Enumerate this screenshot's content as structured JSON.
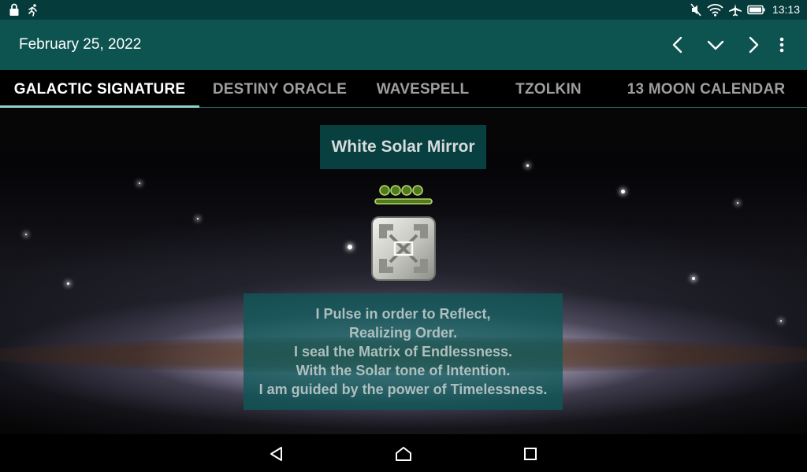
{
  "status_bar": {
    "time": "13:13",
    "left_icons": [
      "lock-icon",
      "running-person-icon"
    ],
    "right_icons": [
      "mute-icon",
      "wifi-icon",
      "airplane-icon",
      "battery-icon"
    ]
  },
  "app_bar": {
    "date": "February 25, 2022",
    "actions": [
      "chevron-left-icon",
      "chevron-down-icon",
      "chevron-right-icon",
      "more-vert-icon"
    ]
  },
  "tabs": [
    {
      "label": "GALACTIC SIGNATURE",
      "active": true
    },
    {
      "label": "DESTINY ORACLE",
      "active": false
    },
    {
      "label": "WAVESPELL",
      "active": false
    },
    {
      "label": "TZOLKIN",
      "active": false
    },
    {
      "label": "13 MOON CALENDAR",
      "active": false
    }
  ],
  "signature": {
    "title": "White Solar Mirror",
    "affirmation": [
      "I Pulse in order to Reflect,",
      "Realizing Order.",
      "I seal the Matrix of Endlessness.",
      "With the Solar tone of Intention.",
      "I am guided by the power of Timelessness."
    ],
    "tone_icon": "solar-tone-glyph-icon",
    "seal_icon": "mirror-seal-glyph-icon"
  },
  "nav_bar": {
    "buttons": [
      "back-icon",
      "home-icon",
      "recents-icon"
    ]
  },
  "colors": {
    "status_bar": "#063b3b",
    "app_bar": "#0d5350",
    "tab_indicator": "#8fd3cb",
    "panel": "#0e5858"
  }
}
